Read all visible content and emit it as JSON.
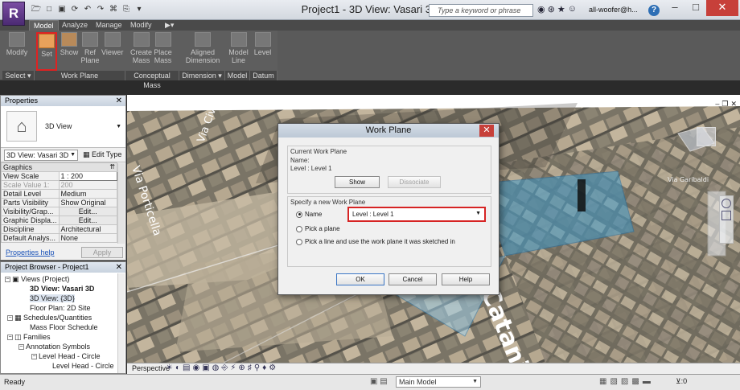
{
  "window": {
    "logo": "R",
    "title": "Project1 - 3D View: Vasari 3D",
    "search_placeholder": "Type a keyword or phrase",
    "user": "all-woofer@h...",
    "help": "?",
    "min": "–",
    "max": "□",
    "close": "✕"
  },
  "ribbon": {
    "tabs": [
      {
        "label": "Model",
        "active": true
      },
      {
        "label": "Analyze"
      },
      {
        "label": "Manage"
      },
      {
        "label": "Modify"
      }
    ],
    "buttons": [
      {
        "label": "Modify"
      },
      {
        "label": "Set",
        "highlighted": true
      },
      {
        "label": "Show"
      },
      {
        "label": "Ref Plane"
      },
      {
        "label": "Viewer"
      },
      {
        "label": "Create Mass"
      },
      {
        "label": "Place Mass"
      },
      {
        "label": "Aligned Dimension"
      },
      {
        "label": "Model Line"
      },
      {
        "label": "Level"
      }
    ],
    "panels": [
      {
        "label": "Select ▾"
      },
      {
        "label": "Work Plane"
      },
      {
        "label": "Conceptual Mass"
      },
      {
        "label": "Dimension ▾"
      },
      {
        "label": "Model"
      },
      {
        "label": "Datum"
      }
    ]
  },
  "properties": {
    "header": "Properties",
    "close": "✕",
    "type_name": "3D View",
    "instance_selector": "3D View: Vasari 3D",
    "edit_type": "Edit Type",
    "rows": [
      {
        "group": "Graphics"
      },
      {
        "name": "View Scale",
        "value": "1 : 200"
      },
      {
        "name": "Scale Value    1:",
        "value": "200",
        "grey": true
      },
      {
        "name": "Detail Level",
        "value": "Medium"
      },
      {
        "name": "Parts Visibility",
        "value": "Show Original"
      },
      {
        "name": "Visibility/Grap...",
        "value": "Edit...",
        "button": true
      },
      {
        "name": "Graphic Displa...",
        "value": "Edit...",
        "button": true
      },
      {
        "name": "Discipline",
        "value": "Architectural"
      },
      {
        "name": "Default Analys...",
        "value": "None"
      }
    ],
    "help_link": "Properties help",
    "apply": "Apply"
  },
  "browser": {
    "header": "Project Browser - Project1",
    "close": "✕",
    "items": [
      {
        "label": "Views (Project)",
        "toggle": "−",
        "level": 0
      },
      {
        "label": "3D View: Vasari 3D",
        "level": 2,
        "bold": true
      },
      {
        "label": "3D View: {3D}",
        "level": 2,
        "selected": true
      },
      {
        "label": "Floor Plan: 2D Site",
        "level": 2
      },
      {
        "label": "Schedules/Quantities",
        "toggle": "−",
        "level": 1
      },
      {
        "label": "Mass Floor Schedule",
        "level": 2
      },
      {
        "label": "Families",
        "toggle": "−",
        "level": 1
      },
      {
        "label": "Annotation Symbols",
        "toggle": "−",
        "level": 2
      },
      {
        "label": "Level Head - Circle",
        "toggle": "−",
        "level": 3
      },
      {
        "label": "Level Head - Circle",
        "level": 4
      }
    ]
  },
  "viewport": {
    "perspective": "Perspective",
    "street_label_1": "Via Porticella",
    "street_label_2": "Via Civico",
    "street_label_3": "Catania",
    "via_label": "Via Garibaldi",
    "controls": [
      "–",
      "❐",
      "✕"
    ]
  },
  "dialog": {
    "title": "Work Plane",
    "close": "✕",
    "current_group": "Current Work Plane",
    "name_label": "Name:",
    "current_value": "Level : Level 1",
    "show_btn": "Show",
    "dissociate_btn": "Dissociate",
    "new_group": "Specify a new Work Plane",
    "opt_name": "Name",
    "name_value": "Level : Level 1",
    "opt_pick_plane": "Pick a plane",
    "opt_pick_line": "Pick a line and use the work plane it was sketched in",
    "ok": "OK",
    "cancel": "Cancel",
    "help": "Help"
  },
  "status": {
    "text": "Ready",
    "model": "Main Model",
    "filter": "⊻:0"
  },
  "colors": {
    "highlight": "#e02222",
    "close_red": "#c7403a",
    "link": "#1a52b8"
  }
}
